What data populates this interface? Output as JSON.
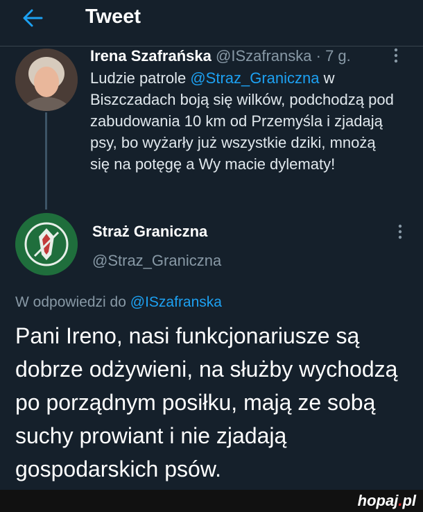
{
  "header": {
    "title": "Tweet"
  },
  "tweet1": {
    "author_name": "Irena Szafrańska",
    "author_handle": "@ISzafranska",
    "separator": " · ",
    "time": "7 g.",
    "text_before": "Ludzie patrole ",
    "mention": "@Straz_Graniczna",
    "text_after": " w Biszczadach boją się wilków, podchodzą pod zabudowania 10 km od Przemyśla i zjadają psy, bo wyżarły już wszystkie dziki, mnożą się na potęgę a Wy macie dylematy!"
  },
  "tweet2": {
    "author_name": "Straż Graniczna",
    "author_handle": "@Straz_Graniczna",
    "reply_prefix": "W odpowiedzi do ",
    "reply_handle": "@ISzafranska",
    "text": "Pani Ireno, nasi funkcjonariusze są dobrze odżywieni, na służby wychodzą po porządnym posiłku, mają ze sobą suchy prowiant i nie zjadają gospodarskich psów."
  },
  "watermark": {
    "brand": "hopaj",
    "dot": ".",
    "tld": "pl"
  },
  "icons": [
    "back-arrow-icon",
    "more-options-icon"
  ],
  "colors": {
    "background": "#15202b",
    "link": "#1da1f2",
    "muted": "#8899a6"
  }
}
